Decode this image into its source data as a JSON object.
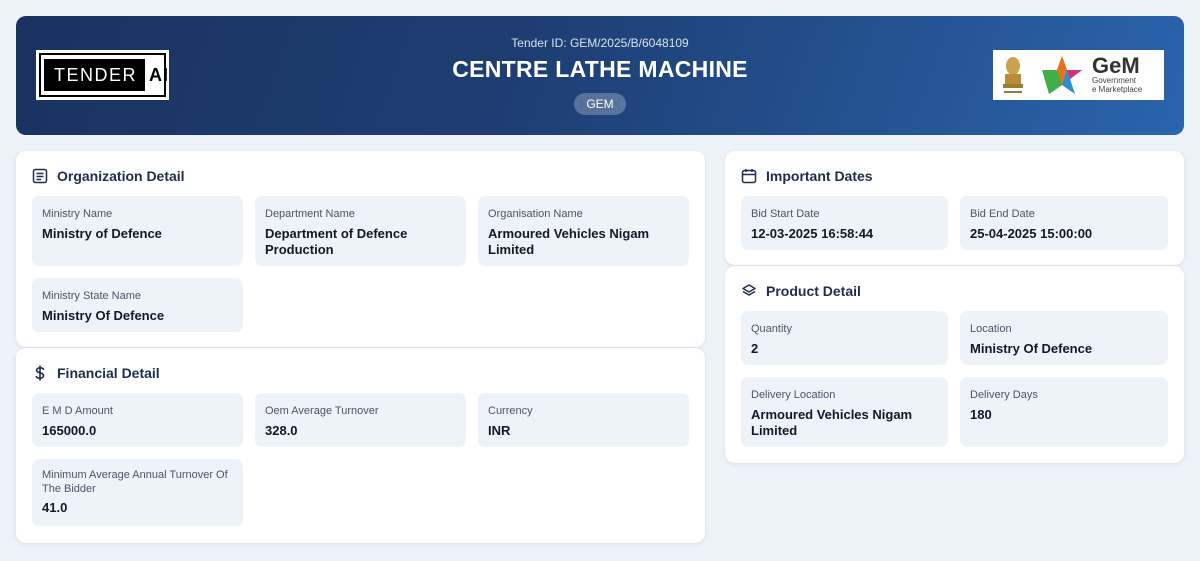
{
  "header": {
    "tender_id": "Tender ID: GEM/2025/B/6048109",
    "title": "CENTRE LATHE MACHINE",
    "badge": "GEM",
    "logo_left": {
      "box_text": "TENDER",
      "suffix": "AI"
    },
    "logo_right": {
      "big": "GeM",
      "line1": "Government",
      "line2": "e Marketplace"
    }
  },
  "organization": {
    "title": "Organization Detail",
    "icon": "document-list-icon",
    "fields": [
      {
        "label": "Ministry Name",
        "value": "Ministry of Defence"
      },
      {
        "label": "Department Name",
        "value": "Department of Defence Production"
      },
      {
        "label": "Organisation Name",
        "value": "Armoured Vehicles Nigam Limited"
      },
      {
        "label": "Ministry State Name",
        "value": "Ministry Of Defence"
      }
    ]
  },
  "financial": {
    "title": "Financial Detail",
    "icon": "dollar-icon",
    "fields": [
      {
        "label": "E M D Amount",
        "value": "165000.0"
      },
      {
        "label": "Oem Average Turnover",
        "value": "328.0"
      },
      {
        "label": "Currency",
        "value": "INR"
      },
      {
        "label": "Minimum Average Annual Turnover Of The Bidder",
        "value": "41.0"
      }
    ]
  },
  "dates": {
    "title": "Important Dates",
    "icon": "calendar-icon",
    "fields": [
      {
        "label": "Bid Start Date",
        "value": "12-03-2025 16:58:44"
      },
      {
        "label": "Bid End Date",
        "value": "25-04-2025 15:00:00"
      }
    ]
  },
  "product": {
    "title": "Product Detail",
    "icon": "layers-icon",
    "fields": [
      {
        "label": "Quantity",
        "value": "2"
      },
      {
        "label": "Location",
        "value": "Ministry Of Defence"
      },
      {
        "label": "Delivery Location",
        "value": "Armoured Vehicles Nigam Limited"
      },
      {
        "label": "Delivery Days",
        "value": "180"
      }
    ]
  },
  "colors": {
    "header_start": "#1a3260",
    "header_end": "#2a64ad",
    "field_bg": "#eef2f9",
    "page_bg": "#eef2f9"
  }
}
